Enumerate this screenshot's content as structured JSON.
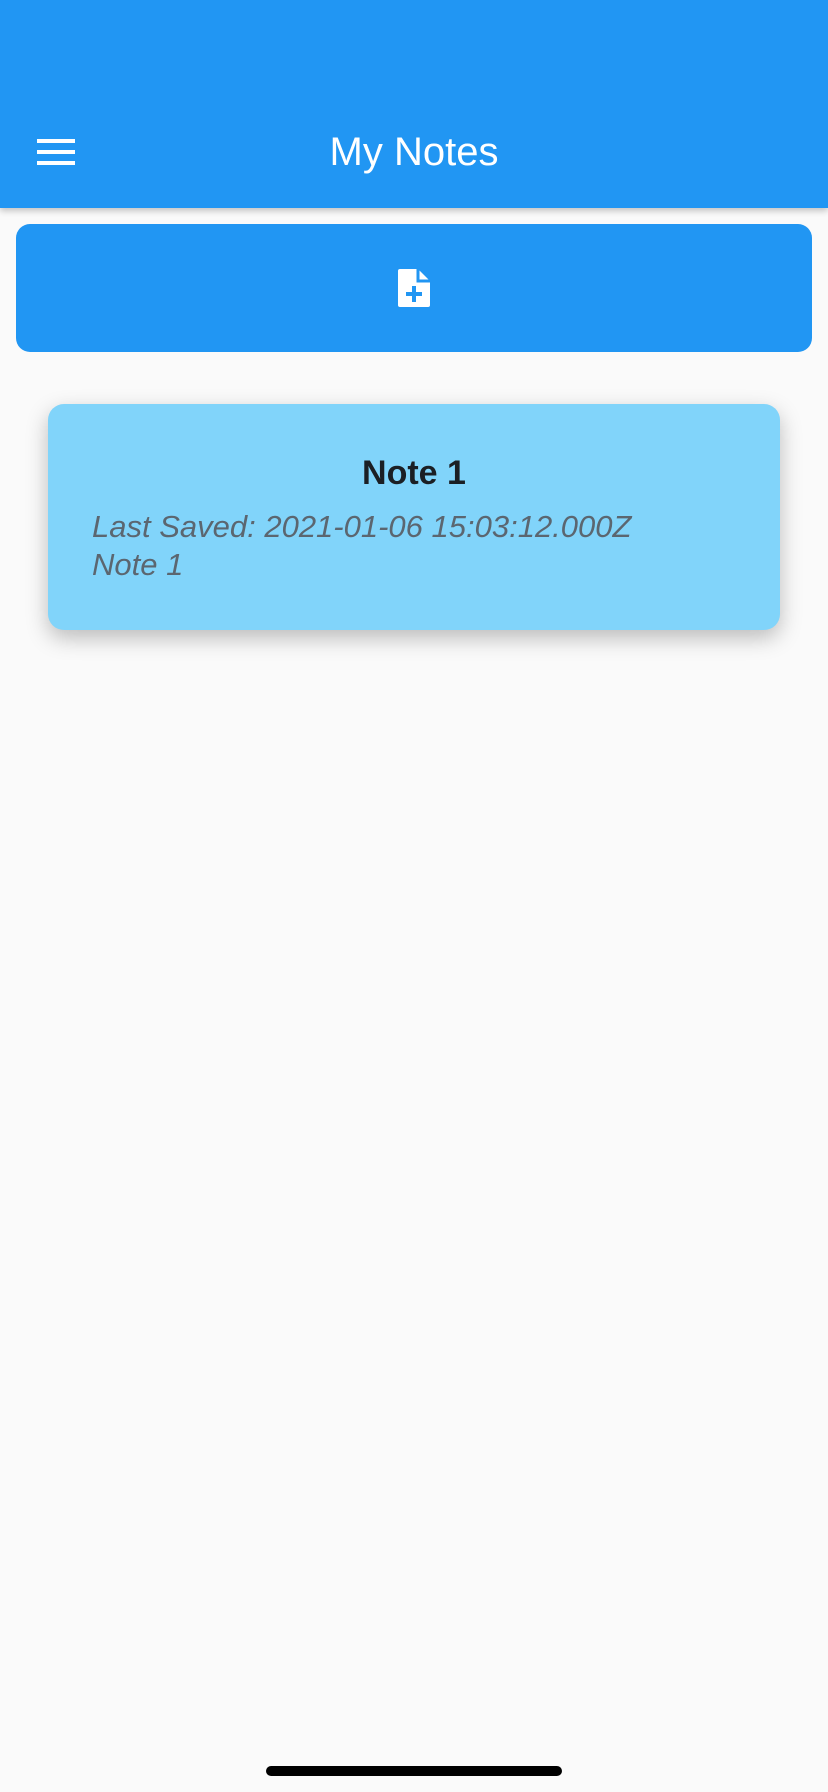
{
  "app_bar": {
    "title": "My Notes",
    "menu_icon": "menu-hamburger",
    "background_color": "#2196f3"
  },
  "add_note_button": {
    "icon": "note-add",
    "color": "#2196f3"
  },
  "notes": [
    {
      "title": "Note 1",
      "last_saved": "Last Saved: 2021-01-06 15:03:12.000Z",
      "body": "Note 1",
      "card_color": "#81d4fa"
    }
  ]
}
